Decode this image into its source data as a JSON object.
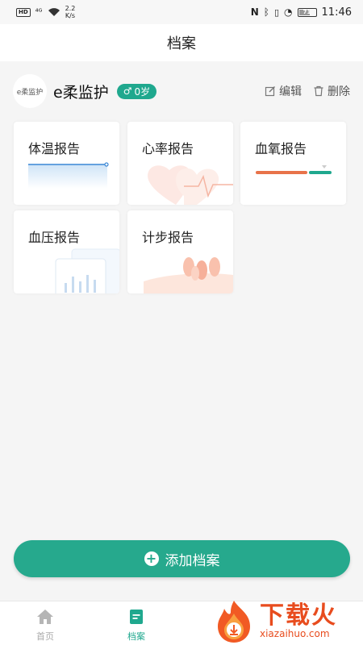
{
  "status_bar": {
    "hd": "HD",
    "signal": "⁴ᴳ",
    "speed_value": "2.2",
    "speed_unit": "K/s",
    "time": "11:46",
    "battery": "71"
  },
  "header": {
    "title": "档案"
  },
  "device": {
    "avatar_text": "e柔监护",
    "name": "e柔监护",
    "badge_symbol": "♂",
    "badge_text": "0岁",
    "edit_label": "编辑",
    "delete_label": "删除"
  },
  "reports": [
    {
      "label": "体温报告"
    },
    {
      "label": "心率报告"
    },
    {
      "label": "血氧报告"
    },
    {
      "label": "血压报告"
    },
    {
      "label": "计步报告"
    }
  ],
  "add_button": {
    "label": "添加档案"
  },
  "tabs": [
    {
      "label": "首页",
      "active": false
    },
    {
      "label": "档案",
      "active": true
    }
  ],
  "watermark": {
    "main": "下载火",
    "sub": "xiazaihuo.com"
  },
  "colors": {
    "accent": "#26a98d",
    "tab_active": "#1fa88e",
    "tab_inactive": "#aaaaaa",
    "spo2_low": "#e8734a"
  }
}
